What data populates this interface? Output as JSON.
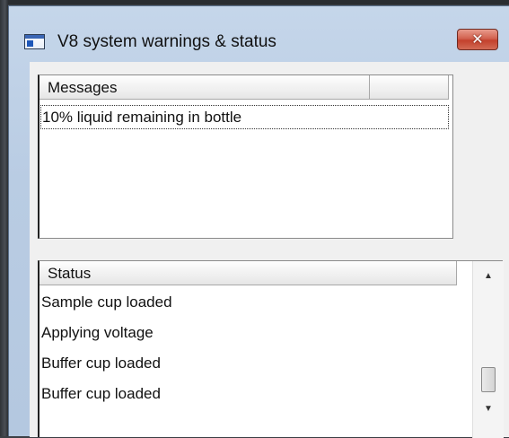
{
  "window": {
    "title": "V8 system warnings & status",
    "close_label": "✕"
  },
  "messages": {
    "columns": [
      "Messages",
      ""
    ],
    "rows": [
      "10% liquid remaining in bottle"
    ]
  },
  "status": {
    "header": "Status",
    "rows": [
      "Sample cup loaded",
      "Applying voltage",
      "Buffer cup loaded",
      "Buffer cup loaded"
    ],
    "scroll_up": "▲",
    "scroll_down": "▼"
  }
}
